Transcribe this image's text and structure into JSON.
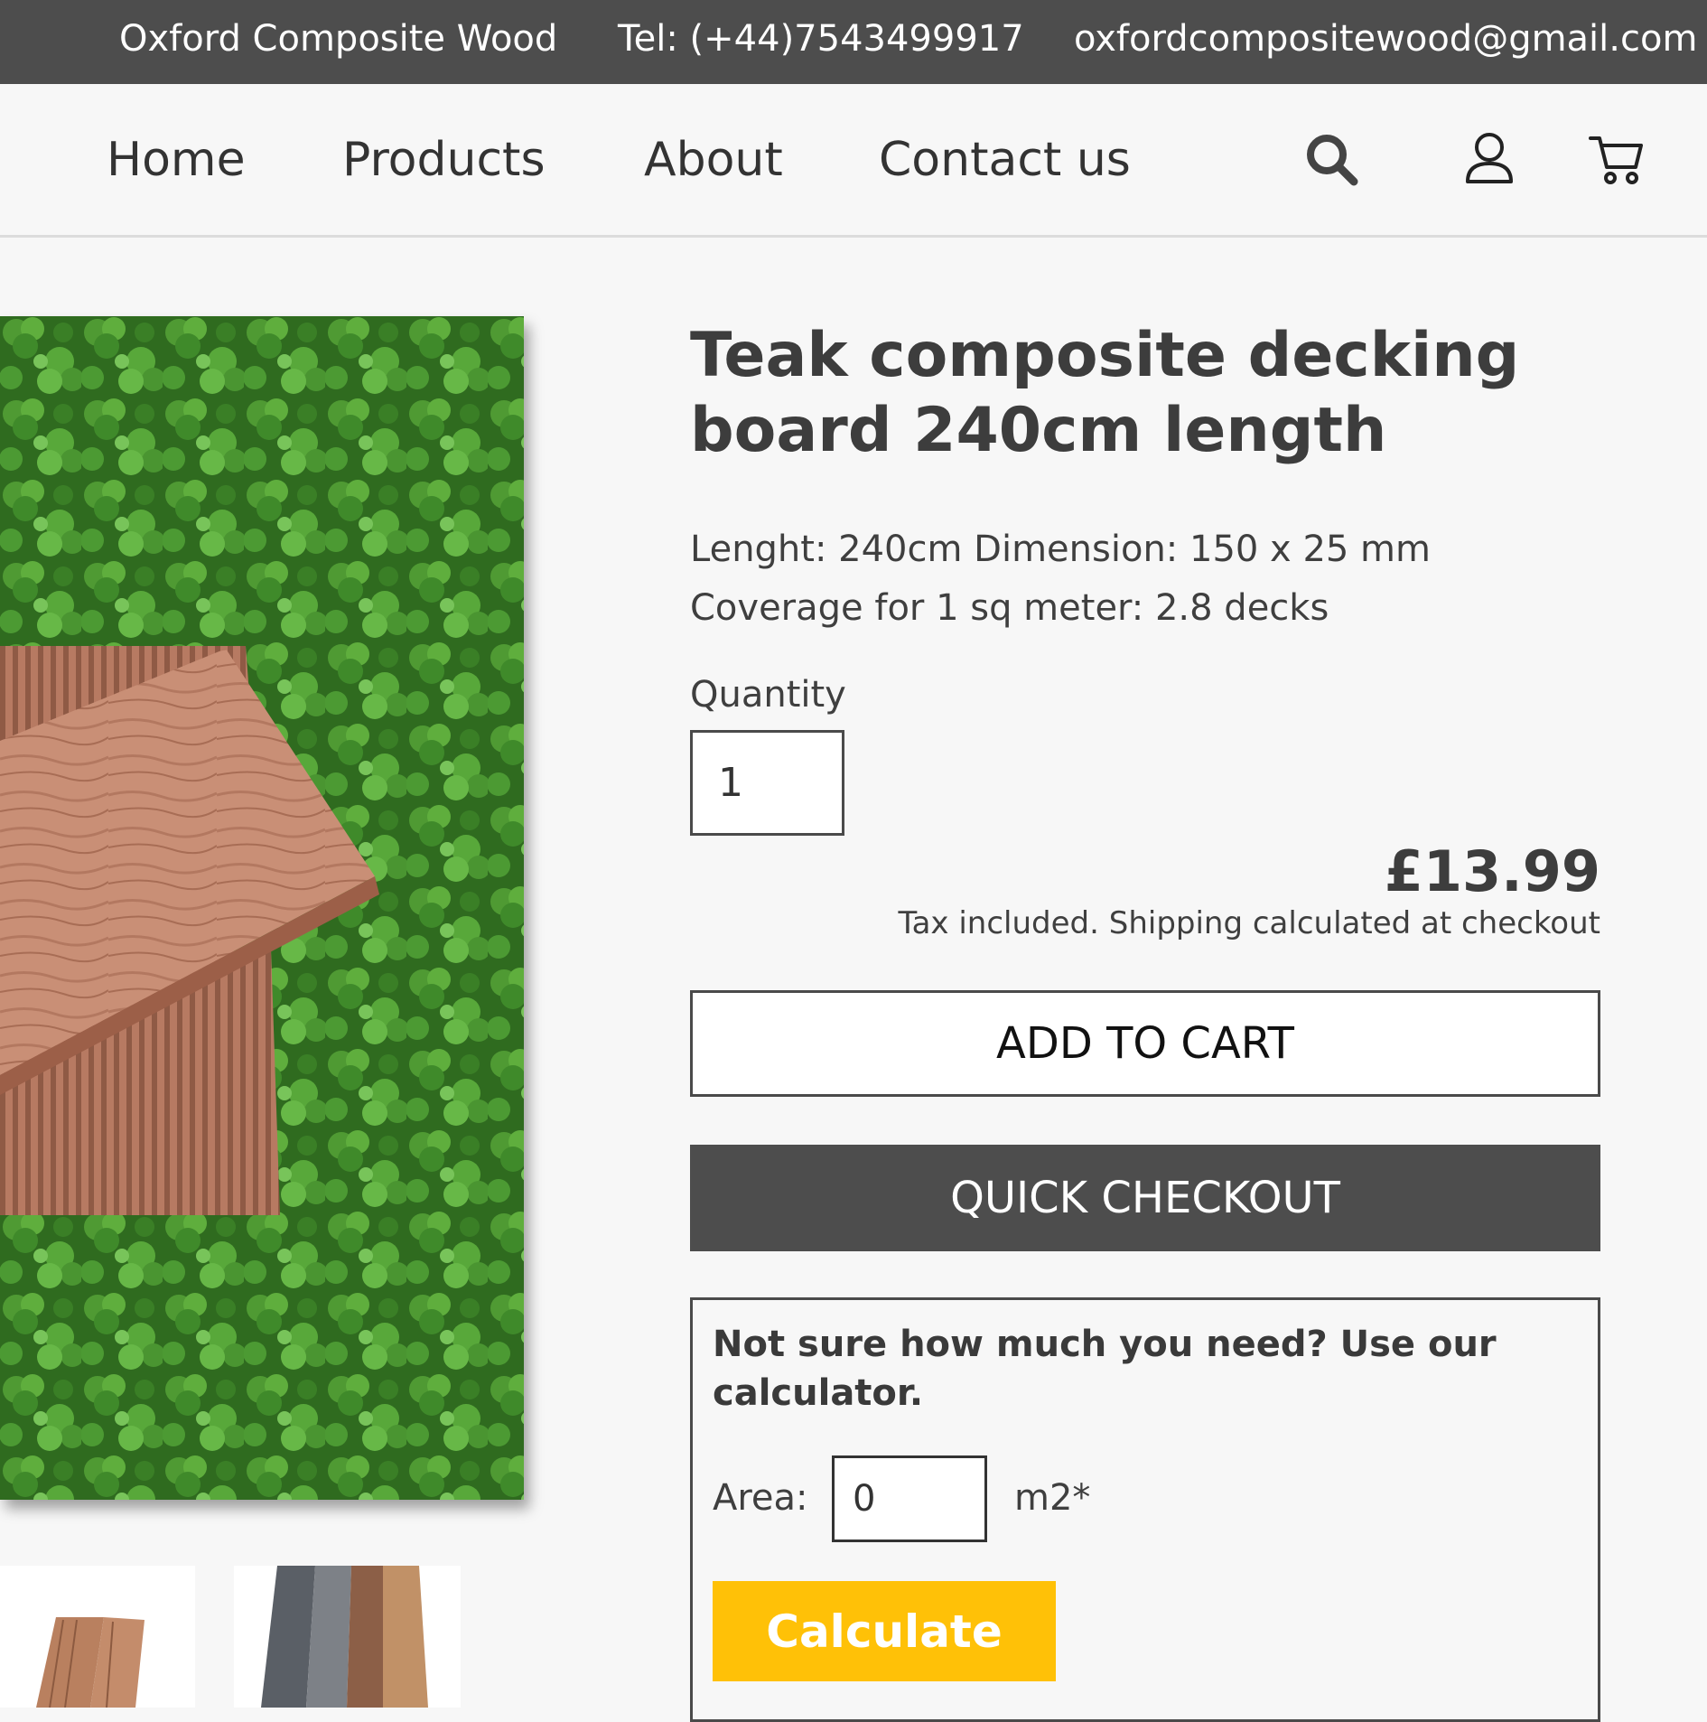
{
  "topbar": {
    "brand": "Oxford Composite Wood",
    "tel": "Tel: (+44)7543499917",
    "email": "oxfordcompositewood@gmail.com"
  },
  "nav": {
    "items": [
      {
        "label": "Home"
      },
      {
        "label": "Products"
      },
      {
        "label": "About"
      },
      {
        "label": "Contact us"
      }
    ],
    "icons": [
      "search-icon",
      "user-icon",
      "cart-icon"
    ]
  },
  "product": {
    "title": "Teak composite decking board 240cm length",
    "spec_line1": "Lenght: 240cm Dimension: 150 x 25 mm",
    "spec_line2": "Coverage for 1 sq meter: 2.8 decks",
    "quantity_label": "Quantity",
    "quantity_value": "1",
    "price": "£13.99",
    "tax_note": "Tax included. Shipping calculated at checkout",
    "add_to_cart_label": "ADD TO CART",
    "quick_checkout_label": "QUICK CHECKOUT"
  },
  "calculator": {
    "title": "Not sure how much you need? Use our calculator.",
    "area_label": "Area:",
    "area_value": "0",
    "area_unit": "m2*",
    "button_label": "Calculate"
  },
  "colors": {
    "topbar_bg": "#4d4d4d",
    "quick_checkout_bg": "#4d4d4d",
    "calculate_bg": "#ffc107",
    "page_bg": "#f7f7f7"
  }
}
